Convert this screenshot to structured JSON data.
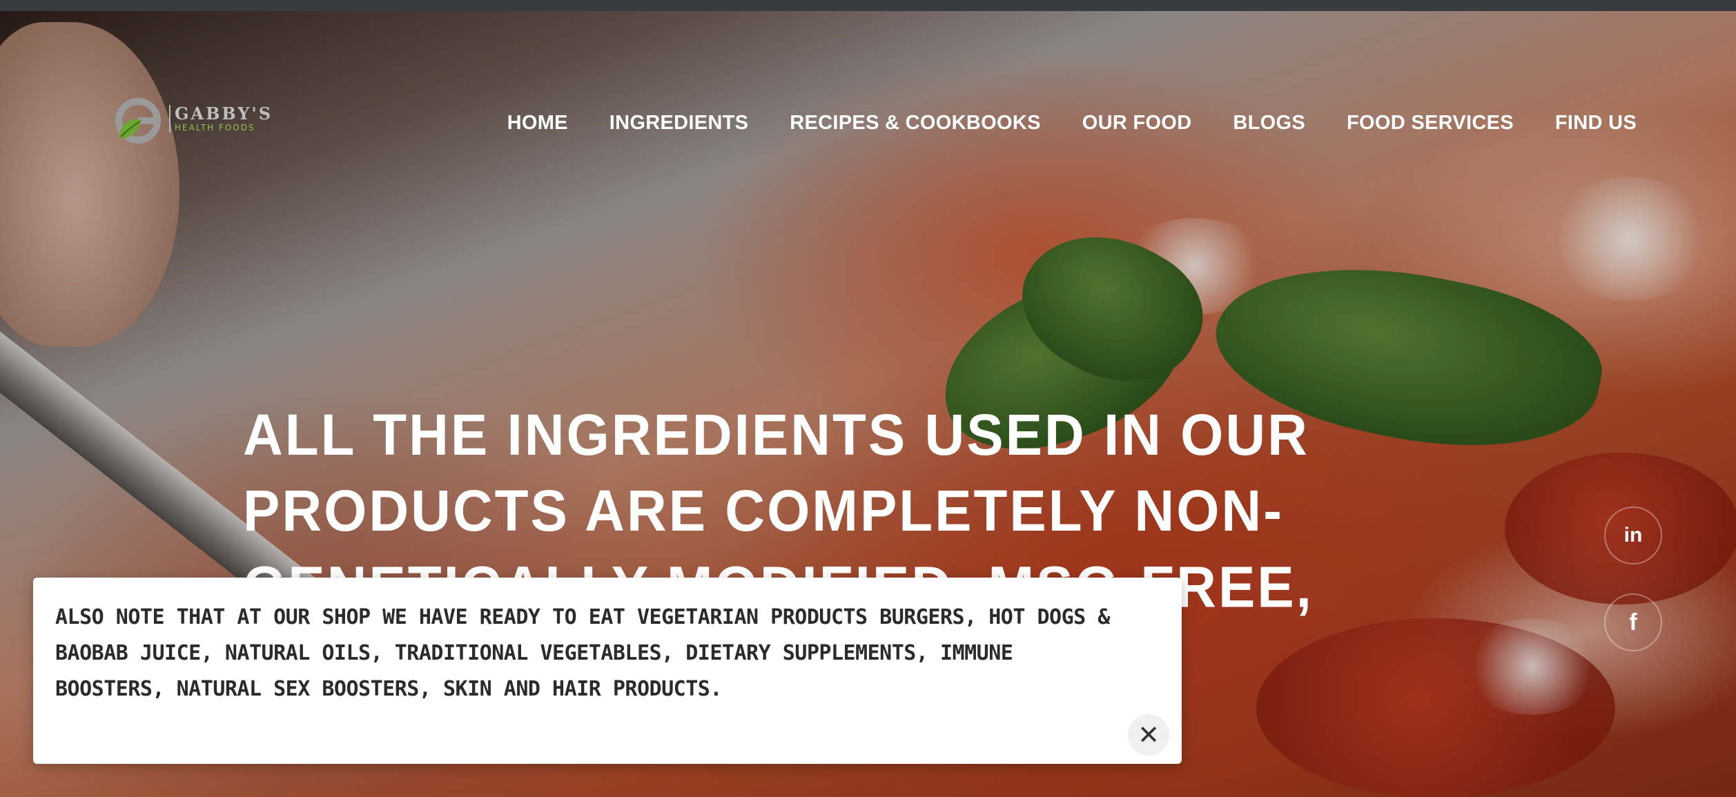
{
  "brand": {
    "name": "GABBY'S",
    "tagline": "HEALTH FOODS",
    "accent_color": "#8bc34a"
  },
  "nav": {
    "items": [
      {
        "label": "HOME"
      },
      {
        "label": "INGREDIENTS"
      },
      {
        "label": "RECIPES & COOKBOOKS"
      },
      {
        "label": "OUR FOOD"
      },
      {
        "label": "BLOGS"
      },
      {
        "label": "FOOD SERVICES"
      },
      {
        "label": "FIND US"
      }
    ]
  },
  "hero": {
    "heading": "ALL THE INGREDIENTS USED IN OUR PRODUCTS ARE COMPLETELY NON-GENETICALLY MODIFIED, MSG-FREE, AND VEGAN."
  },
  "social": {
    "linkedin_icon": "in",
    "facebook_icon": "f"
  },
  "notice": {
    "text": "ALSO NOTE THAT AT OUR SHOP WE HAVE READY TO EAT VEGETARIAN PRODUCTS BURGERS, HOT DOGS & BAOBAB JUICE, NATURAL OILS, TRADITIONAL VEGETABLES, DIETARY SUPPLEMENTS, IMMUNE BOOSTERS, NATURAL SEX BOOSTERS, SKIN AND HAIR PRODUCTS.",
    "close_icon": "✕"
  }
}
